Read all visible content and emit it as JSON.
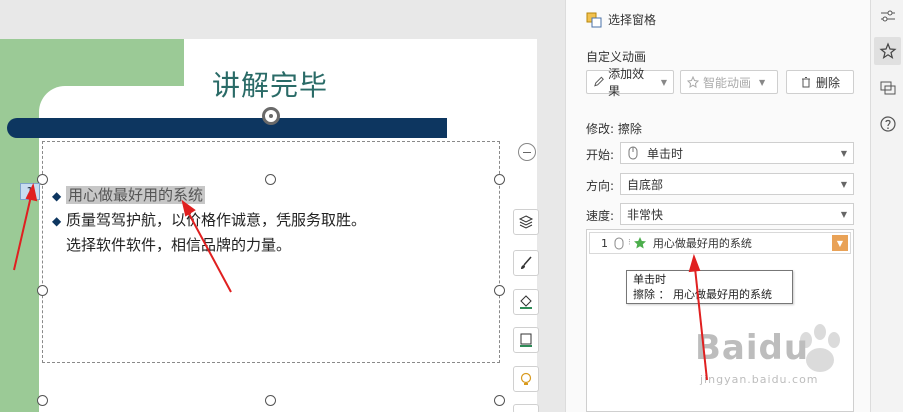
{
  "slide": {
    "title": "讲解完毕",
    "anim_badge": "1",
    "lines": [
      {
        "text": "用心做最好用的系统",
        "bullet": "◆"
      },
      {
        "text": "质量驾驾护航，以价格作诚意，凭服务取胜。",
        "bullet": "◆"
      },
      {
        "text": "选择软件软件，相信品牌的力量。",
        "bullet": ""
      }
    ]
  },
  "pane": {
    "title": "选择窗格",
    "section": "自定义动画",
    "buttons": {
      "add_effect": "添加效果",
      "smart_anim": "智能动画",
      "delete": "删除"
    },
    "modify_label": "修改: 擦除",
    "fields": {
      "start_label": "开始:",
      "start_value": "单击时",
      "direction_label": "方向:",
      "direction_value": "自底部",
      "speed_label": "速度:",
      "speed_value": "非常快"
    },
    "list_item": {
      "num": "1",
      "text": "用心做最好用的系统"
    },
    "tooltip": {
      "line1": "单击时",
      "line2": "擦除 ： 用心做最好用的系统"
    }
  },
  "watermark": {
    "brand": "Baidu",
    "sub": "jingyan.baidu.com"
  },
  "colors": {
    "slide_green": "#9bca96",
    "title_teal": "#2a6b67",
    "bar_navy": "#0d3660",
    "drop_orange": "#e9a257",
    "arrow_red": "#e02020"
  }
}
